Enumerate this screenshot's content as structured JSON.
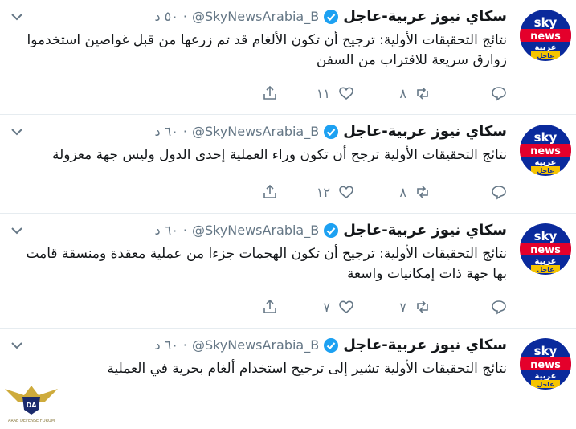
{
  "tweets": [
    {
      "name": "سكاي نيوز عربية-عاجل",
      "handle": "@SkyNewsArabia_B",
      "time": "٥٠ د",
      "text": "نتائج التحقيقات الأولية: ترجيح أن تكون الألغام قد تم زرعها من قبل غواصين استخدموا زوارق سريعة للاقتراب من السفن",
      "retweets": "٨",
      "likes": "١١"
    },
    {
      "name": "سكاي نيوز عربية-عاجل",
      "handle": "@SkyNewsArabia_B",
      "time": "٦٠ د",
      "text": "نتائج التحقيقات الأولية ترجح أن تكون وراء العملية إحدى الدول وليس جهة معزولة",
      "retweets": "٨",
      "likes": "١٢"
    },
    {
      "name": "سكاي نيوز عربية-عاجل",
      "handle": "@SkyNewsArabia_B",
      "time": "٦٠ د",
      "text": "نتائج التحقيقات الأولية: ترجيح أن تكون الهجمات جزءا من عملية معقدة ومنسقة قامت بها جهة ذات إمكانيات واسعة",
      "retweets": "٧",
      "likes": "٧"
    },
    {
      "name": "سكاي نيوز عربية-عاجل",
      "handle": "@SkyNewsArabia_B",
      "time": "٦٠ د",
      "text": "نتائج التحقيقات الأولية تشير إلى ترجيح استخدام ألغام بحرية في العملية",
      "retweets": "",
      "likes": ""
    }
  ],
  "avatar": {
    "line1": "sky",
    "line2": "news",
    "line3": "عربية",
    "line4": "عاجل"
  },
  "watermark": {
    "line1": "DA",
    "line2": "ARAB DEFENSE FORUM"
  },
  "icons": [
    "reply-icon",
    "retweet-icon",
    "like-icon",
    "share-icon",
    "caret-down-icon",
    "verified-badge-icon"
  ],
  "colors": {
    "accent": "#1da1f2",
    "muted": "#657786",
    "divider": "#e6ecf0",
    "sky_red": "#e4002b",
    "sky_blue": "#0a2a9c",
    "breaking_yellow": "#f5c400"
  }
}
